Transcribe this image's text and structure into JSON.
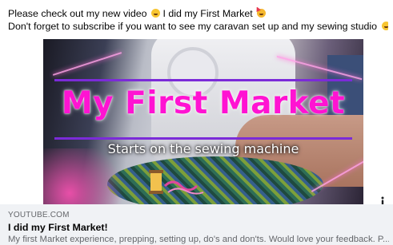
{
  "post": {
    "line1": "Please check out my new video",
    "line1_mid": "I did my First Market",
    "line2": "Don't forget to subscribe if you want to see my caravan set up and my sewing studio"
  },
  "video_thumbnail": {
    "title": "My First Market",
    "subtitle": "Starts on the sewing machine",
    "title_color": "#ff13d2",
    "bar_color": "#7b2bd8"
  },
  "link_preview": {
    "domain": "YOUTUBE.COM",
    "title": "I did my First Market!",
    "description": "My first Market experience, prepping, setting up, do's and don'ts. Would love your feedback. P..."
  },
  "icons": [
    "grinning-emoji-icon",
    "partying-emoji-icon",
    "info-icon"
  ]
}
